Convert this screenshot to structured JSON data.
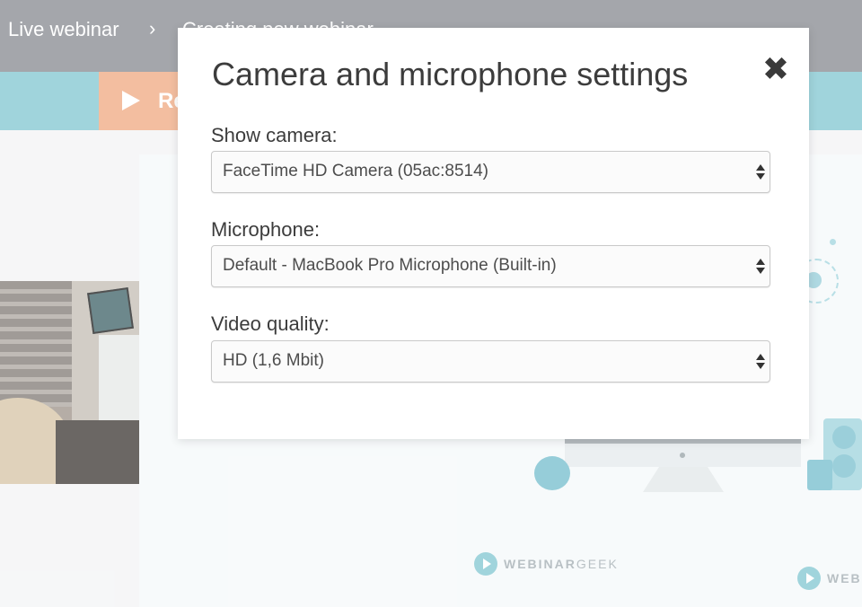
{
  "header": {
    "breadcrumb_root": "Live webinar",
    "breadcrumb_separator": "›",
    "breadcrumb_current": "Creating new webinar"
  },
  "toolbar": {
    "record_label": "Re",
    "record_icon": "play-icon"
  },
  "brand": {
    "logo_text_bold": "WEBINAR",
    "logo_text_light": "GEEK",
    "logo_text_cut": "WEBI"
  },
  "modal": {
    "title": "Camera and microphone settings",
    "close_icon": "close-icon",
    "fields": {
      "camera": {
        "label": "Show camera:",
        "value": "FaceTime HD Camera (05ac:8514)"
      },
      "microphone": {
        "label": "Microphone:",
        "value": "Default - MacBook Pro Microphone (Built-in)"
      },
      "quality": {
        "label": "Video quality:",
        "value": "HD (1,6 Mbit)"
      }
    }
  },
  "colors": {
    "topbar": "#909399",
    "tealbar": "#8ccbd5",
    "record_button": "#f1b08c",
    "modal_bg": "#ffffff"
  }
}
